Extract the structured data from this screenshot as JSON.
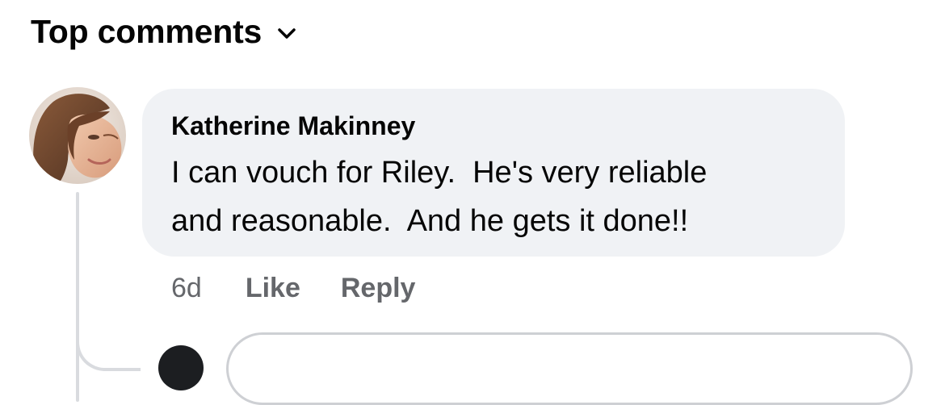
{
  "header": {
    "sort_label": "Top comments",
    "sort_icon": "chevron-down-icon"
  },
  "comment": {
    "author": "Katherine Makinney",
    "text": "I can vouch for Riley.  He's very reliable\nand reasonable.  And he gets it done!!",
    "time": "6d",
    "like_label": "Like",
    "reply_label": "Reply"
  },
  "colors": {
    "bubble_bg": "#f0f2f5",
    "text": "#050505",
    "secondary_text": "#65676b",
    "thread_line": "#d9dbdf"
  }
}
